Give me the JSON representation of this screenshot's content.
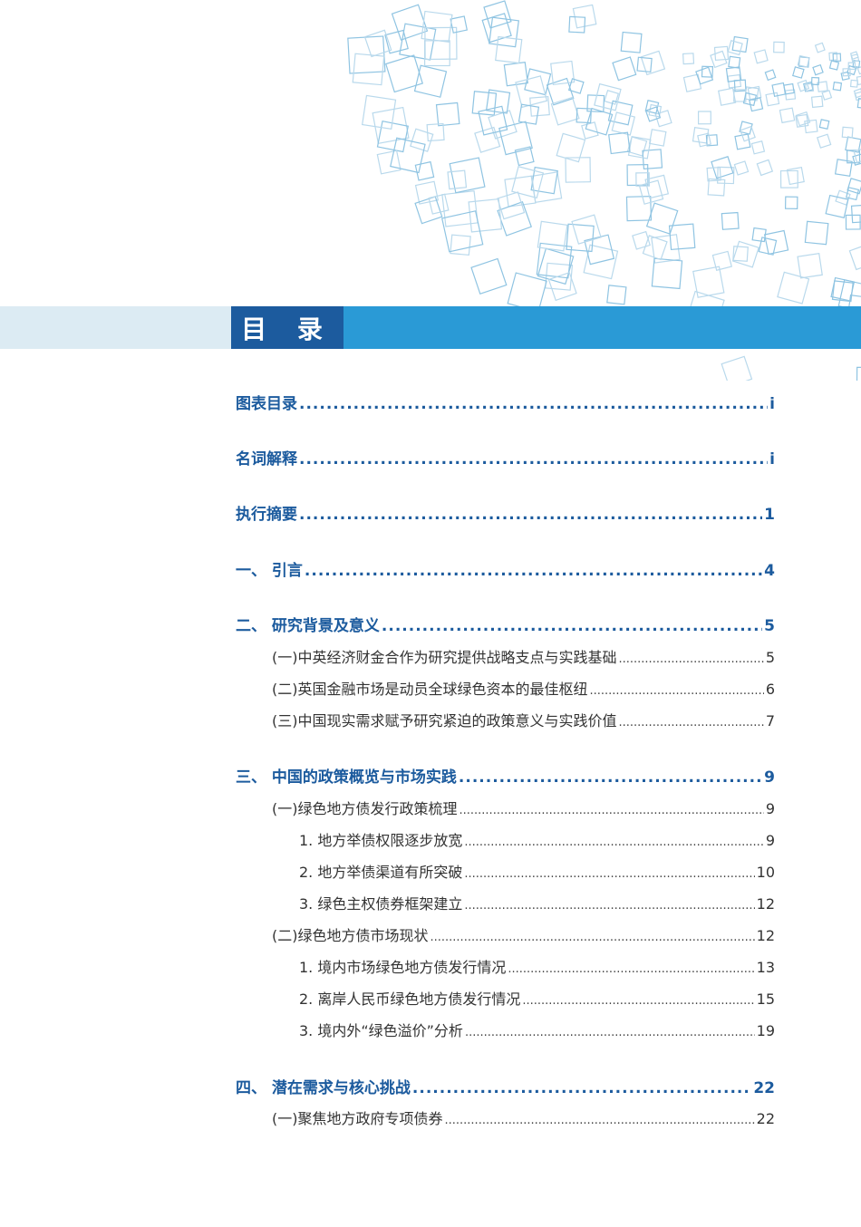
{
  "title": "目 录",
  "entries": [
    {
      "label": "图表目录",
      "page": "i",
      "level": 1
    },
    {
      "label": "名词解释",
      "page": "i",
      "level": 1
    },
    {
      "label": "执行摘要",
      "page": "1",
      "level": 1
    },
    {
      "label": "一、 引言",
      "page": "4",
      "level": 1
    },
    {
      "label": "二、 研究背景及意义",
      "page": "5",
      "level": 1
    },
    {
      "label": "(一)中英经济财金合作为研究提供战略支点与实践基础",
      "page": "5",
      "level": 2
    },
    {
      "label": "(二)英国金融市场是动员全球绿色资本的最佳枢纽",
      "page": "6",
      "level": 2
    },
    {
      "label": "(三)中国现实需求赋予研究紧迫的政策意义与实践价值",
      "page": "7",
      "level": 2
    },
    {
      "label": "三、 中国的政策概览与市场实践",
      "page": "9",
      "level": 1
    },
    {
      "label": "(一)绿色地方债发行政策梳理",
      "page": "9",
      "level": 2
    },
    {
      "label": "1. 地方举债权限逐步放宽",
      "page": "9",
      "level": 3
    },
    {
      "label": "2. 地方举债渠道有所突破",
      "page": "10",
      "level": 3
    },
    {
      "label": "3. 绿色主权债券框架建立",
      "page": "12",
      "level": 3
    },
    {
      "label": "(二)绿色地方债市场现状",
      "page": "12",
      "level": 2
    },
    {
      "label": "1. 境内市场绿色地方债发行情况",
      "page": "13",
      "level": 3
    },
    {
      "label": "2. 离岸人民币绿色地方债发行情况",
      "page": "15",
      "level": 3
    },
    {
      "label": "3. 境内外“绿色溢价”分析",
      "page": "19",
      "level": 3
    },
    {
      "label": "四、 潜在需求与核心挑战",
      "page": "22",
      "level": 1
    },
    {
      "label": "(一)聚焦地方政府专项债券",
      "page": "22",
      "level": 2
    }
  ]
}
